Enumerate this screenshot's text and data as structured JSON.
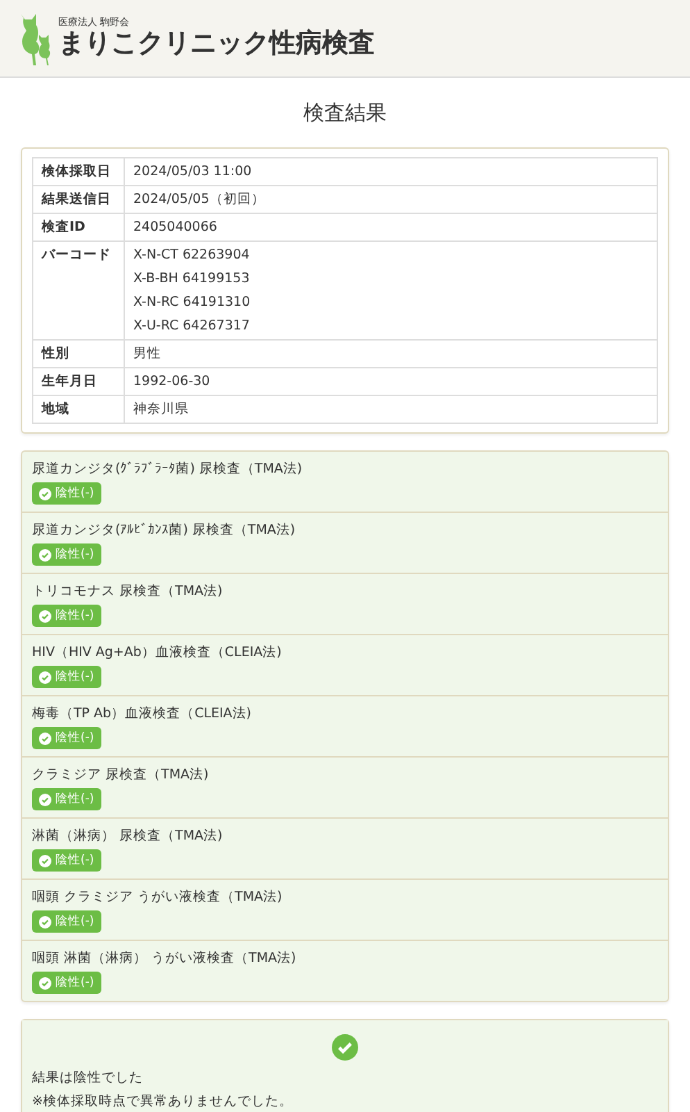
{
  "header": {
    "org": "医療法人 駒野会",
    "title": "まりこクリニック性病検査"
  },
  "page_title": "検査結果",
  "info": [
    {
      "label": "検体採取日",
      "values": [
        "2024/05/03 11:00"
      ]
    },
    {
      "label": "結果送信日",
      "values": [
        "2024/05/05（初回）"
      ]
    },
    {
      "label": "検査ID",
      "values": [
        "2405040066"
      ]
    },
    {
      "label": "バーコード",
      "values": [
        "X-N-CT 62263904",
        "X-B-BH 64199153",
        "X-N-RC 64191310",
        "X-U-RC 64267317"
      ]
    },
    {
      "label": "性別",
      "values": [
        "男性"
      ]
    },
    {
      "label": "生年月日",
      "values": [
        "1992-06-30"
      ]
    },
    {
      "label": "地域",
      "values": [
        "神奈川県"
      ]
    }
  ],
  "results": [
    {
      "test": "尿道カンジタ(ｸﾞﾗﾌﾞﾗｰﾀ菌) 尿検査（TMA法)",
      "kind": "negative",
      "result": "陰性(-)"
    },
    {
      "test": "尿道カンジタ(ｱﾙﾋﾞｶﾝｽ菌) 尿検査（TMA法)",
      "kind": "negative",
      "result": "陰性(-)"
    },
    {
      "test": "トリコモナス 尿検査（TMA法)",
      "kind": "negative",
      "result": "陰性(-)"
    },
    {
      "test": "HIV（HIV Ag+Ab）血液検査（CLEIA法)",
      "kind": "negative",
      "result": "陰性(-)"
    },
    {
      "test": "梅毒（TP Ab）血液検査（CLEIA法)",
      "kind": "negative",
      "result": "陰性(-)"
    },
    {
      "test": "クラミジア 尿検査（TMA法)",
      "kind": "negative",
      "result": "陰性(-)"
    },
    {
      "test": "淋菌（淋病） 尿検査（TMA法)",
      "kind": "negative",
      "result": "陰性(-)"
    },
    {
      "test": "咽頭 クラミジア うがい液検査（TMA法)",
      "kind": "negative",
      "result": "陰性(-)"
    },
    {
      "test": "咽頭 淋菌（淋病） うがい液検査（TMA法)",
      "kind": "negative",
      "result": "陰性(-)"
    }
  ],
  "summary": {
    "kind": "negative",
    "lines": [
      "結果は陰性でした",
      "※検体採取時点で異常ありませんでした。"
    ]
  }
}
